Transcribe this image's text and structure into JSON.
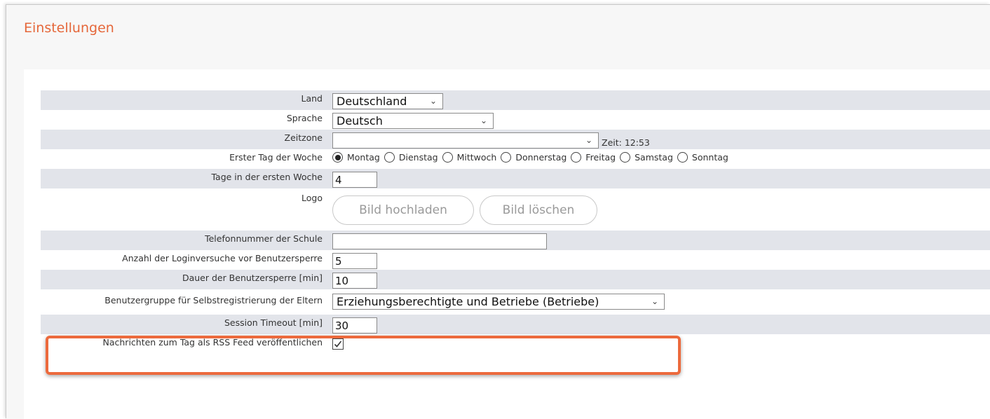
{
  "page_title": "Einstellungen",
  "colors": {
    "accent": "#e5673a",
    "highlight": "#ec6a3d",
    "row_alt": "#e2e4ea"
  },
  "fields": {
    "land": {
      "label": "Land",
      "value": "Deutschland"
    },
    "sprache": {
      "label": "Sprache",
      "value": "Deutsch"
    },
    "zeitzone": {
      "label": "Zeitzone",
      "value": "",
      "note": "Zeit: 12:53"
    },
    "erster_tag": {
      "label": "Erster Tag der Woche",
      "options": [
        "Montag",
        "Dienstag",
        "Mittwoch",
        "Donnerstag",
        "Freitag",
        "Samstag",
        "Sonntag"
      ],
      "selected": "Montag"
    },
    "tage_erste_woche": {
      "label": "Tage in der ersten Woche",
      "value": "4"
    },
    "logo": {
      "label": "Logo",
      "upload_label": "Bild hochladen",
      "delete_label": "Bild löschen"
    },
    "telefon": {
      "label": "Telefonnummer der Schule",
      "value": ""
    },
    "loginversuche": {
      "label": "Anzahl der Loginversuche vor Benutzersperre",
      "value": "5"
    },
    "sperre_dauer": {
      "label": "Dauer der Benutzersperre [min]",
      "value": "10"
    },
    "benutzergruppe": {
      "label": "Benutzergruppe für Selbstregistrierung der Eltern",
      "value": "Erziehungsberechtigte und Betriebe (Betriebe)"
    },
    "session_timeout": {
      "label": "Session Timeout [min]",
      "value": "30"
    },
    "rss": {
      "label": "Nachrichten zum Tag als RSS Feed veröffentlichen",
      "checked": true
    }
  },
  "icons": {
    "chevron": "chevron-down-icon",
    "check": "checkmark-icon"
  }
}
